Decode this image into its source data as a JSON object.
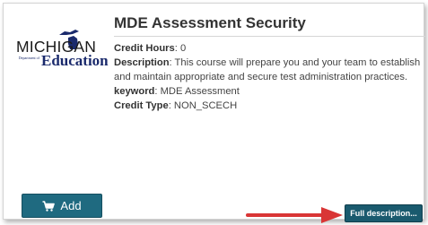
{
  "logo": {
    "michigan": "MICHIGAN",
    "department": "Department of",
    "education": "Education"
  },
  "course": {
    "title": "MDE Assessment Security",
    "credit_hours_label": "Credit Hours",
    "credit_hours_value": ": 0",
    "description_label": "Description",
    "description_line1": ": This course will prepare you and your team to establish",
    "description_line2": "and maintain appropriate and secure test administration practices.",
    "keyword_label": "keyword",
    "keyword_value": ": MDE Assessment",
    "credit_type_label": "Credit Type",
    "credit_type_value": ": NON_SCECH"
  },
  "actions": {
    "add_label": "Add",
    "add_icon": "cart-icon",
    "full_description_label": "Full description..."
  },
  "colors": {
    "button": "#1f6a80",
    "full_button": "#1a5a6e",
    "arrow": "#d93535",
    "logo_blue": "#1a2a6c"
  }
}
